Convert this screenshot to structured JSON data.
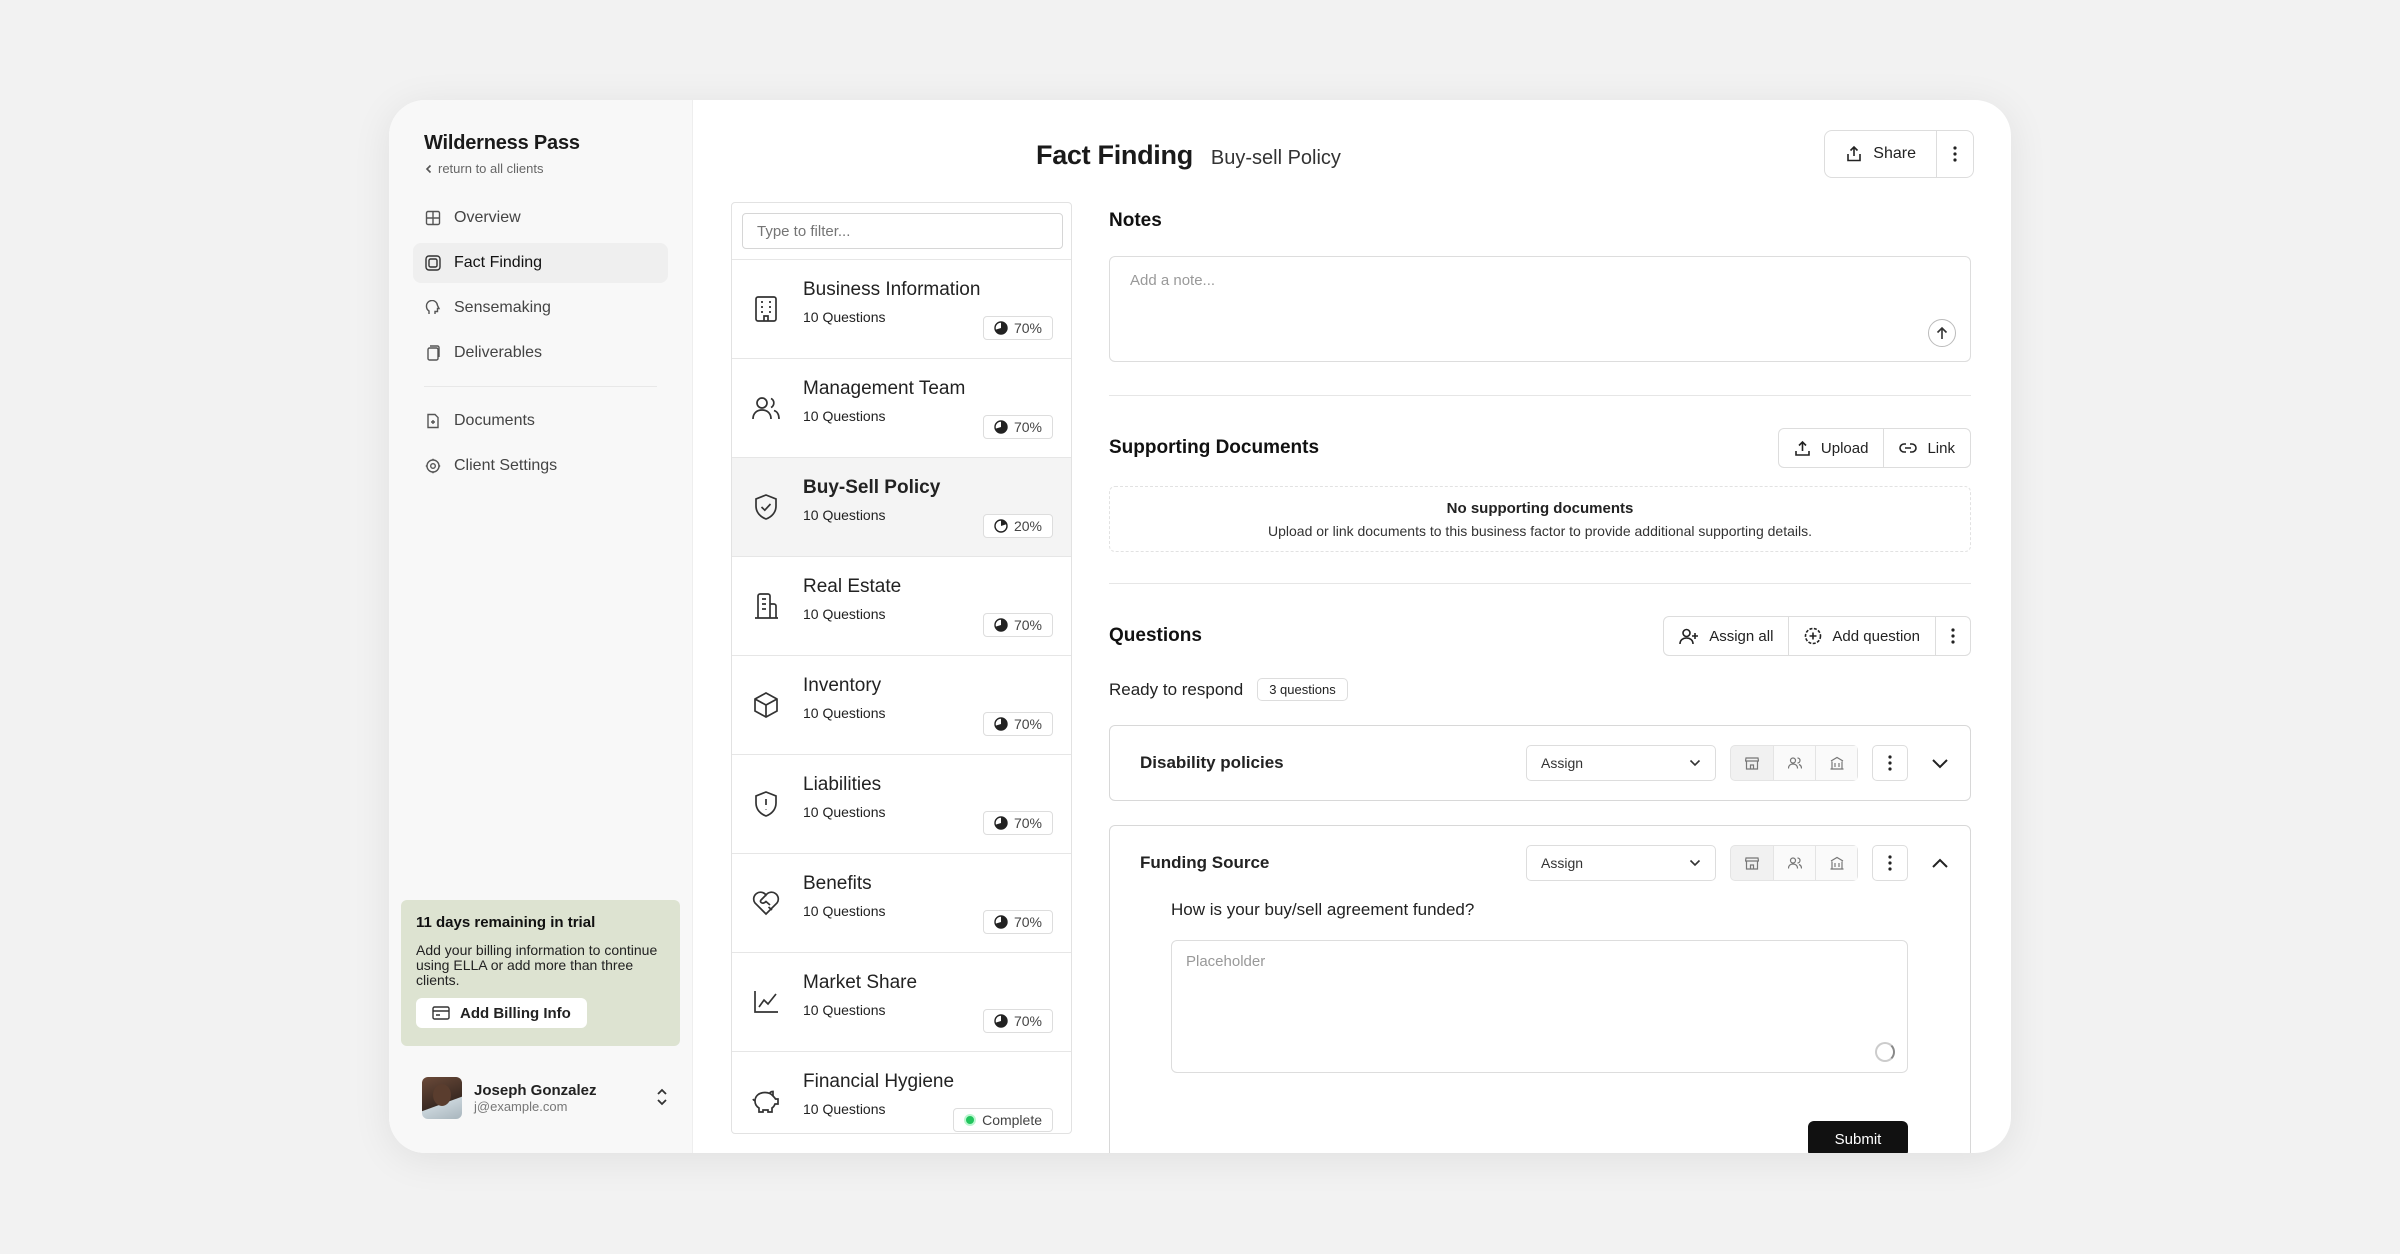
{
  "sidebar": {
    "brand": "Wilderness Pass",
    "back_link": "return to all clients",
    "nav": [
      {
        "label": "Overview",
        "icon": "grid-icon"
      },
      {
        "label": "Fact Finding",
        "icon": "book-icon",
        "active": true
      },
      {
        "label": "Sensemaking",
        "icon": "brain-icon"
      },
      {
        "label": "Deliverables",
        "icon": "file-stack-icon"
      }
    ],
    "nav2": [
      {
        "label": "Documents",
        "icon": "document-icon"
      },
      {
        "label": "Client Settings",
        "icon": "gear-icon"
      }
    ],
    "trial": {
      "title": "11 days remaining in trial",
      "text": "Add your billing information to continue using ELLA or add more than three clients.",
      "button": "Add Billing Info"
    },
    "user": {
      "name": "Joseph Gonzalez",
      "email": "j@example.com"
    }
  },
  "header": {
    "title": "Fact Finding",
    "subtitle": "Buy-sell Policy",
    "share_label": "Share"
  },
  "filter": {
    "placeholder": "Type to filter..."
  },
  "categories": [
    {
      "title": "Business Information",
      "questions": "10 Questions",
      "progress": "70%",
      "icon": "building-icon"
    },
    {
      "title": "Management Team",
      "questions": "10 Questions",
      "progress": "70%",
      "icon": "users-icon"
    },
    {
      "title": "Buy-Sell Policy",
      "questions": "10 Questions",
      "progress": "20%",
      "icon": "shield-check-icon",
      "active": true
    },
    {
      "title": "Real Estate",
      "questions": "10 Questions",
      "progress": "70%",
      "icon": "buildings-icon"
    },
    {
      "title": "Inventory",
      "questions": "10 Questions",
      "progress": "70%",
      "icon": "box-icon"
    },
    {
      "title": "Liabilities",
      "questions": "10 Questions",
      "progress": "70%",
      "icon": "shield-alert-icon"
    },
    {
      "title": "Benefits",
      "questions": "10 Questions",
      "progress": "70%",
      "icon": "heart-handshake-icon"
    },
    {
      "title": "Market Share",
      "questions": "10 Questions",
      "progress": "70%",
      "icon": "line-chart-icon"
    },
    {
      "title": "Financial Hygiene",
      "questions": "10 Questions",
      "progress": "Complete",
      "icon": "piggy-bank-icon"
    }
  ],
  "notes": {
    "title": "Notes",
    "placeholder": "Add a note..."
  },
  "supporting": {
    "title": "Supporting Documents",
    "upload": "Upload",
    "link": "Link",
    "empty_title": "No supporting documents",
    "empty_sub": "Upload or link documents to this business factor to provide additional supporting details."
  },
  "questions": {
    "title": "Questions",
    "assign_all": "Assign all",
    "add_question": "Add question",
    "ready_label": "Ready to respond",
    "ready_count": "3 questions",
    "items": [
      {
        "title": "Disability policies",
        "assign": "Assign",
        "expanded": false
      },
      {
        "title": "Funding Source",
        "assign": "Assign",
        "expanded": true,
        "question": "How is your buy/sell agreement funded?",
        "placeholder": "Placeholder",
        "submit": "Submit"
      }
    ]
  },
  "colors": {
    "trial_bg": "#dde3d1",
    "complete_dot": "#22c55e",
    "submit_bg": "#111111"
  }
}
